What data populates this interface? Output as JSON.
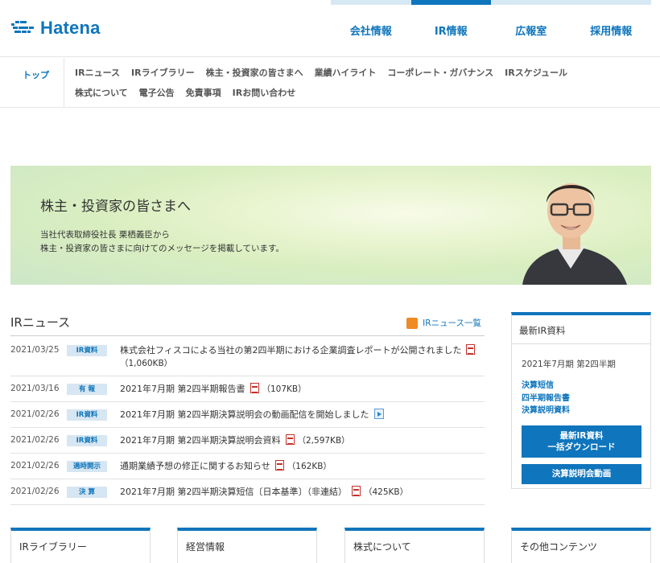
{
  "header": {
    "logo_text": "Hatena",
    "nav": [
      {
        "label": "会社情報",
        "active": false
      },
      {
        "label": "IR情報",
        "active": true
      },
      {
        "label": "広報室",
        "active": false
      },
      {
        "label": "採用情報",
        "active": false
      }
    ]
  },
  "subnav": {
    "top_label": "トップ",
    "links": [
      "IRニュース",
      "IRライブラリー",
      "株主・投資家の皆さまへ",
      "業績ハイライト",
      "コーポレート・ガバナンス",
      "IRスケジュール",
      "株式について",
      "電子公告",
      "免責事項",
      "IRお問い合わせ"
    ]
  },
  "banner": {
    "title": "株主・投資家の皆さまへ",
    "line1": "当社代表取締役社長 栗栖義臣から",
    "line2": "株主・投資家の皆さまに向けてのメッセージを掲載しています。"
  },
  "news": {
    "title": "IRニュース",
    "list_link": "IRニュース一覧",
    "items": [
      {
        "date": "2021/03/25",
        "category": "IR資料",
        "text": "株式会社フィスコによる当社の第2四半期における企業調査レポートが公開されました",
        "size": "（1,060KB）"
      },
      {
        "date": "2021/03/16",
        "category": "有 報",
        "text": "2021年7月期 第2四半期報告書",
        "size": "（107KB）"
      },
      {
        "date": "2021/02/26",
        "category": "IR資料",
        "text": "2021年7月期 第2四半期決算説明会の動画配信を開始しました",
        "size": ""
      },
      {
        "date": "2021/02/26",
        "category": "IR資料",
        "text": "2021年7月期 第2四半期決算説明会資料",
        "size": "（2,597KB）"
      },
      {
        "date": "2021/02/26",
        "category": "適時開示",
        "text": "通期業績予想の修正に関するお知らせ",
        "size": "（162KB）"
      },
      {
        "date": "2021/02/26",
        "category": "決 算",
        "text": "2021年7月期 第2四半期決算短信〔日本基準〕（非連結）",
        "size": "（425KB）"
      }
    ]
  },
  "sidebar": {
    "title": "最新IR資料",
    "period": "2021年7月期 第2四半期",
    "links": [
      "決算短信",
      "四半期報告書",
      "決算説明資料"
    ],
    "download_line1": "最新IR資料",
    "download_line2": "一括ダウンロード",
    "video_button": "決算説明会動画"
  },
  "bottom": [
    "IRライブラリー",
    "経営情報",
    "株式について",
    "その他コンテンツ"
  ],
  "colors": {
    "brand": "#0f75bc",
    "tag_bg": "#d6e6f2",
    "pdf": "#c2302a",
    "rss": "#f08a24"
  }
}
